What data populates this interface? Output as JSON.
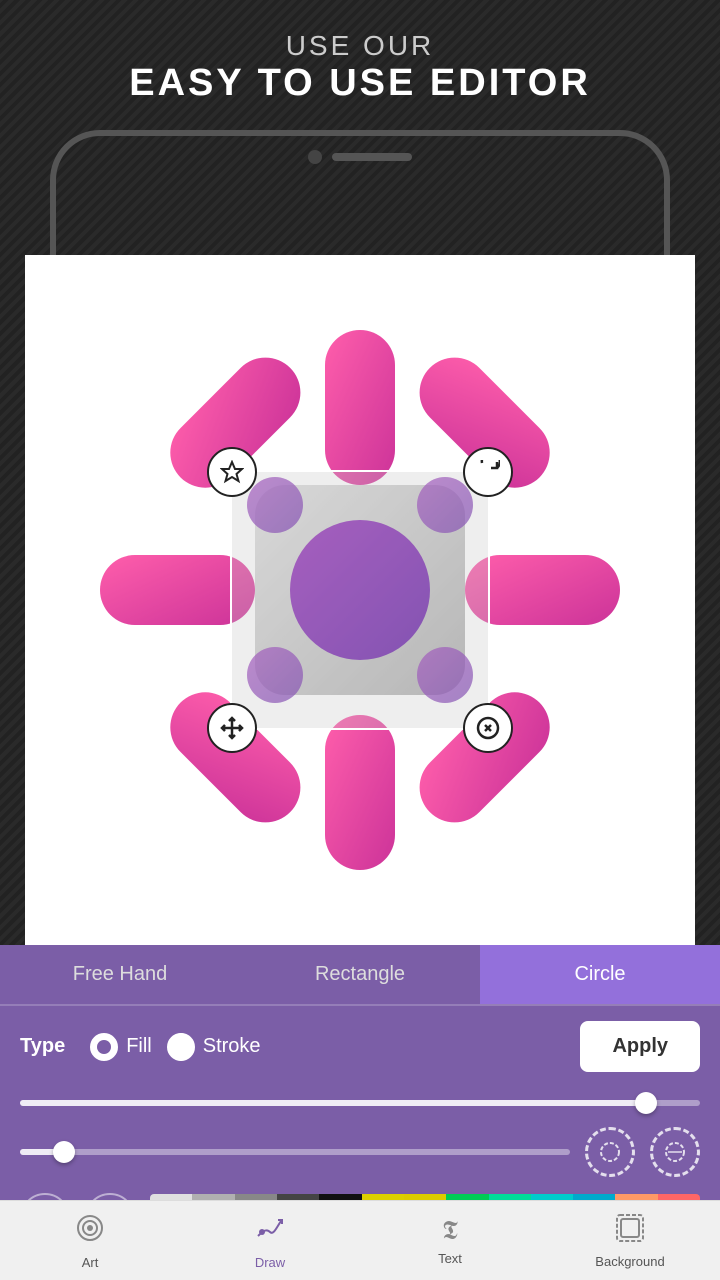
{
  "header": {
    "line1": "USE OUR",
    "line2": "EASY TO USE EDITOR"
  },
  "tabs": [
    {
      "label": "Free Hand",
      "active": false
    },
    {
      "label": "Rectangle",
      "active": false
    },
    {
      "label": "Circle",
      "active": true
    }
  ],
  "toolbar": {
    "type_label": "Type",
    "fill_label": "Fill",
    "stroke_label": "Stroke",
    "apply_label": "Apply"
  },
  "slider1": {
    "fill_pct": 92
  },
  "slider2": {
    "fill_pct": 8
  },
  "colors": [
    "#e0e0e0",
    "#b0b0b0",
    "#888888",
    "#444444",
    "#111111",
    "#ddd000",
    "#ddcc00",
    "#00cc55",
    "#00dd99",
    "#00cccc",
    "#00aacc",
    "#ff9966",
    "#ff6666"
  ],
  "nav_items": [
    {
      "label": "Art",
      "icon": "⚙",
      "active": false
    },
    {
      "label": "Draw",
      "icon": "🎨",
      "active": true
    },
    {
      "label": "Text",
      "icon": "𝕿",
      "active": false
    },
    {
      "label": "Background",
      "icon": "▣",
      "active": false
    }
  ]
}
